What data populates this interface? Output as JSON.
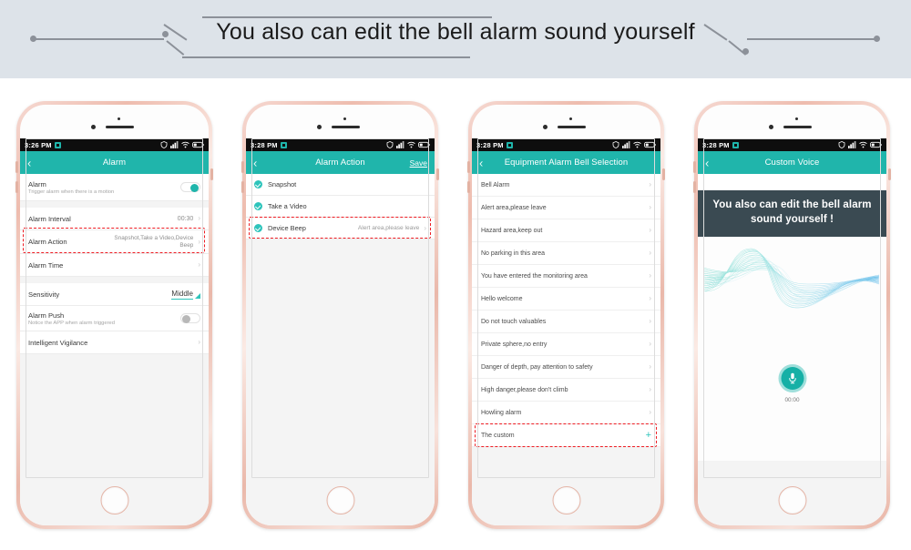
{
  "banner": {
    "title": "You also can edit the bell alarm sound yourself",
    "background": "#dde3e9",
    "line_color": "#8c9199"
  },
  "colors": {
    "teal": "#20b5ab",
    "teal_light": "#2ec4bb",
    "dark_slate": "#3a4a52",
    "highlight_red": "#ee1c23",
    "frame_rose": "#eebcae"
  },
  "phones": [
    {
      "status": {
        "time": "3:26 PM",
        "icons": [
          "app-icon",
          "shield-icon",
          "signal-icon",
          "wifi-icon",
          "battery-icon"
        ]
      },
      "header": {
        "title": "Alarm",
        "back": "‹",
        "action": ""
      },
      "rows": [
        {
          "label": "Alarm",
          "sub": "Trigger alarm when there is a motion",
          "control": "toggle-on"
        },
        {
          "label": "Alarm Interval",
          "sub": "",
          "value": "00:30",
          "control": "chevron"
        },
        {
          "label": "Alarm Action",
          "sub": "",
          "value": "Snapshot,Take a Video,Device Beep",
          "control": "chevron",
          "highlighted": true
        },
        {
          "label": "Alarm Time",
          "sub": "",
          "value": "",
          "control": "chevron"
        },
        {
          "label": "Sensitivity",
          "sub": "",
          "value": "Middle",
          "control": "dropdown"
        },
        {
          "label": "Alarm Push",
          "sub": "Notice the APP when alarm triggered",
          "control": "toggle-off"
        },
        {
          "label": "Intelligent Vigilance",
          "sub": "",
          "value": "",
          "control": "chevron"
        }
      ]
    },
    {
      "status": {
        "time": "3:28 PM"
      },
      "header": {
        "title": "Alarm Action",
        "back": "‹",
        "action": "Save"
      },
      "checks": [
        {
          "label": "Snapshot",
          "value": "",
          "checked": true,
          "highlighted": false
        },
        {
          "label": "Take a Video",
          "value": "",
          "checked": true,
          "highlighted": false
        },
        {
          "label": "Device Beep",
          "value": "Alert area,please leave",
          "checked": true,
          "highlighted": true
        }
      ]
    },
    {
      "status": {
        "time": "3:28 PM"
      },
      "header": {
        "title": "Equipment Alarm Bell Selection",
        "back": "‹",
        "action": ""
      },
      "options": [
        {
          "label": "Bell Alarm",
          "trailing": "chevron"
        },
        {
          "label": "Alert area,please leave",
          "trailing": "chevron"
        },
        {
          "label": "Hazard area,keep out",
          "trailing": "chevron"
        },
        {
          "label": "No parking in this area",
          "trailing": "chevron"
        },
        {
          "label": "You have entered the monitoring area",
          "trailing": "chevron"
        },
        {
          "label": "Hello welcome",
          "trailing": "chevron"
        },
        {
          "label": "Do not touch valuables",
          "trailing": "chevron"
        },
        {
          "label": "Private sphere,no entry",
          "trailing": "chevron"
        },
        {
          "label": "Danger of depth, pay attention to safety",
          "trailing": "chevron"
        },
        {
          "label": "High danger,please don't climb",
          "trailing": "chevron"
        },
        {
          "label": "Howling alarm",
          "trailing": "chevron"
        },
        {
          "label": "The custom",
          "trailing": "plus",
          "highlighted": true
        }
      ]
    },
    {
      "status": {
        "time": "3:28 PM"
      },
      "header": {
        "title": "Custom Voice",
        "back": "‹",
        "action": ""
      },
      "promo_text": "You also can edit the bell alarm sound yourself !",
      "record": {
        "timer": "00:00",
        "icon": "microphone-icon"
      }
    }
  ]
}
